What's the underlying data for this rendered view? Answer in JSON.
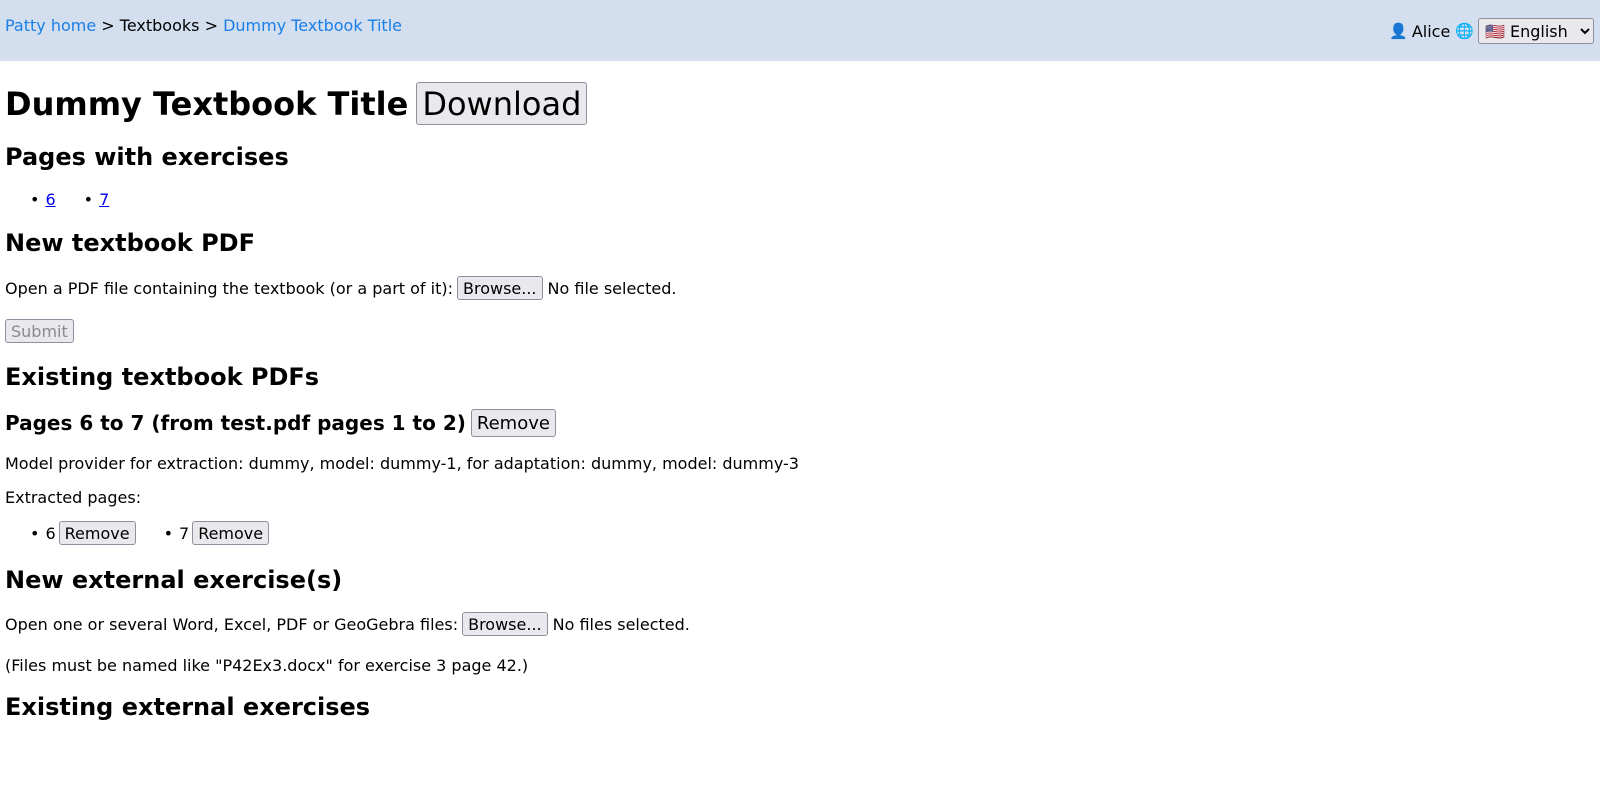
{
  "breadcrumb": {
    "home": "Patty home",
    "sep1": " > ",
    "section": "Textbooks",
    "sep2": " > ",
    "current": "Dummy Textbook Title"
  },
  "user": {
    "name": "Alice",
    "language": "🇺🇸 English"
  },
  "title": "Dummy Textbook Title",
  "download_label": "Download",
  "pages_with_exercises": {
    "heading": "Pages with exercises",
    "pages": [
      "6",
      "7"
    ]
  },
  "new_pdf": {
    "heading": "New textbook PDF",
    "label": "Open a PDF file containing the textbook (or a part of it):",
    "browse": "Browse...",
    "status": "No file selected.",
    "submit": "Submit"
  },
  "existing_pdfs": {
    "heading": "Existing textbook PDFs",
    "entry_title": "Pages 6 to 7 (from test.pdf pages 1 to 2)",
    "remove": "Remove",
    "model_info": "Model provider for extraction: dummy, model: dummy-1, for adaptation: dummy, model: dummy-3",
    "extracted_label": "Extracted pages:",
    "extracted_pages": [
      {
        "page": "6",
        "remove": "Remove"
      },
      {
        "page": "7",
        "remove": "Remove"
      }
    ]
  },
  "new_external": {
    "heading": "New external exercise(s)",
    "label": "Open one or several Word, Excel, PDF or GeoGebra files:",
    "browse": "Browse...",
    "status": "No files selected.",
    "note": "(Files must be named like \"P42Ex3.docx\" for exercise 3 page 42.)"
  },
  "existing_external": {
    "heading": "Existing external exercises"
  }
}
